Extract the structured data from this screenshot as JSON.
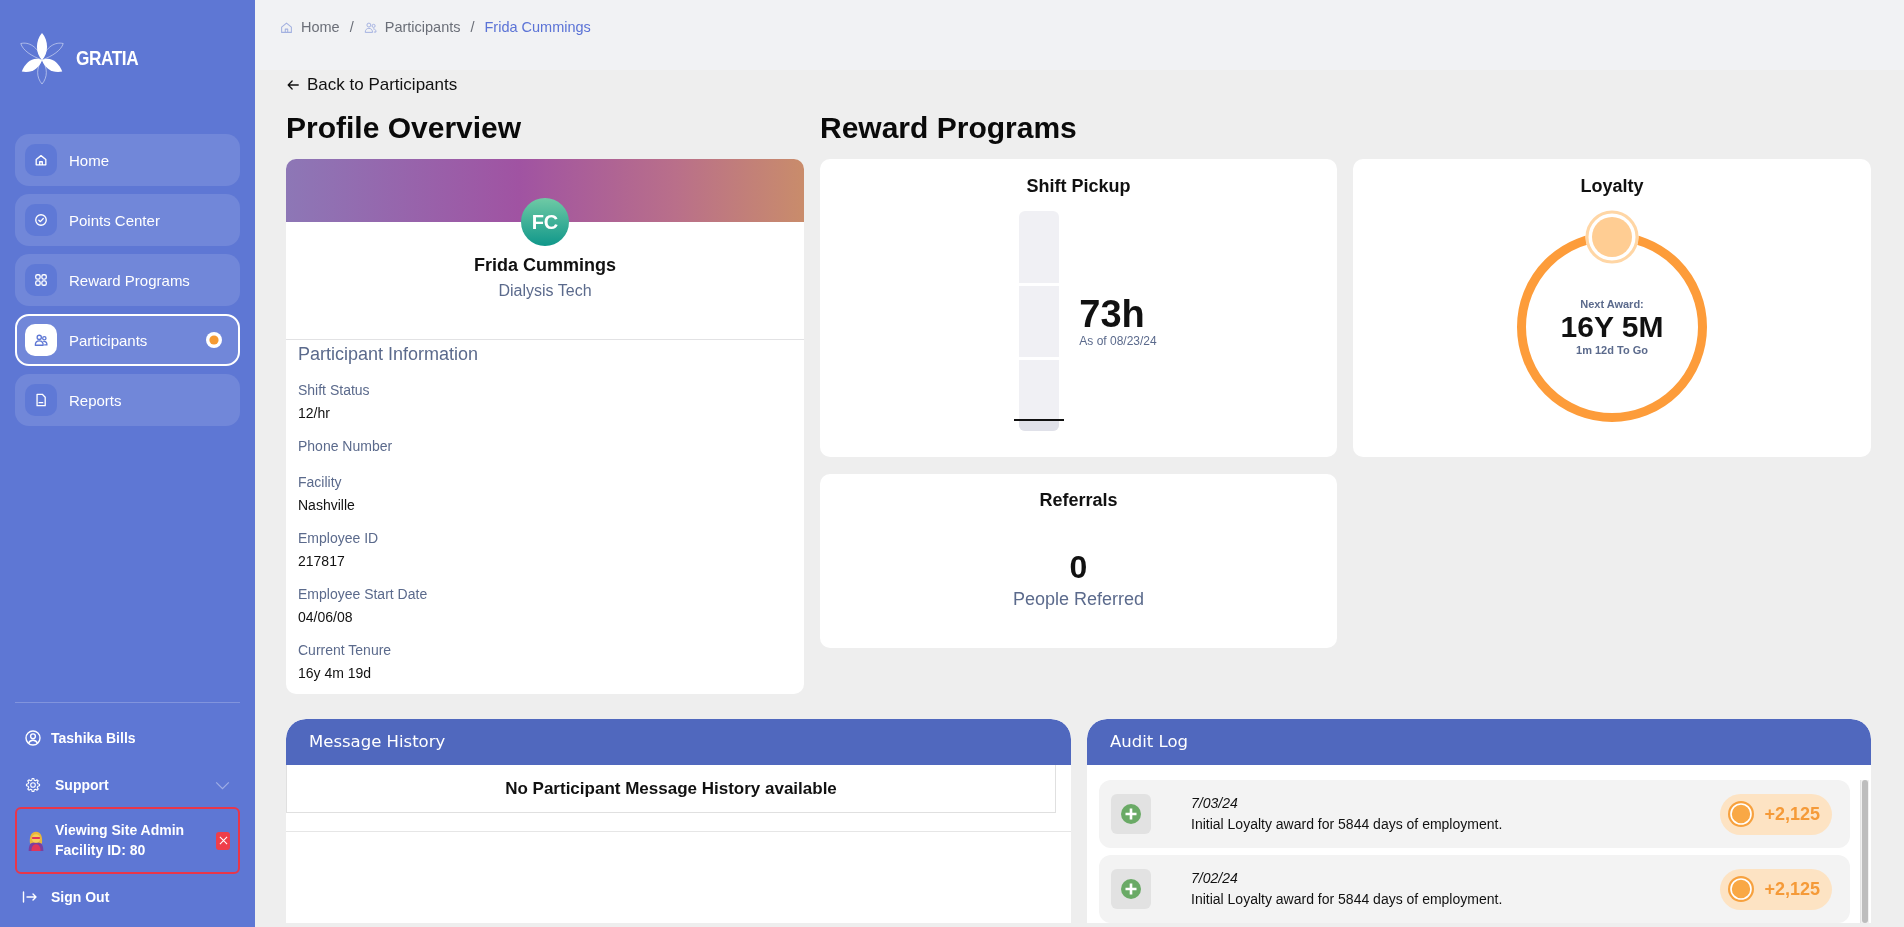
{
  "sidebar": {
    "logo_text": "GRATIA",
    "nav": [
      {
        "label": "Home",
        "selected": false,
        "notification": false
      },
      {
        "label": "Points Center",
        "selected": false,
        "notification": false
      },
      {
        "label": "Reward Programs",
        "selected": false,
        "notification": false
      },
      {
        "label": "Participants",
        "selected": true,
        "notification": true
      },
      {
        "label": "Reports",
        "selected": false,
        "notification": false
      }
    ],
    "user_name": "Tashika Bills",
    "support": {
      "label": "Support",
      "expanded": false
    },
    "impersonation": {
      "title": "Viewing Site Admin",
      "facility": "Facility ID: 80"
    },
    "sign_out": "Sign Out"
  },
  "breadcrumb": [
    {
      "label": "Home",
      "separator": "/",
      "current": false
    },
    {
      "label": "Participants",
      "separator": "/",
      "current": false
    },
    {
      "label": "Frida Cummings",
      "current": true
    }
  ],
  "back_link": "Back to Participants",
  "profile": {
    "title": "Profile Overview",
    "initials": "FC",
    "name": "Frida Cummings",
    "role": "Dialysis Tech",
    "section_title": "Participant Information",
    "fields": [
      {
        "label": "Shift Status",
        "value": "12/hr"
      },
      {
        "label": "Phone Number"
      },
      {
        "label": "Facility",
        "value": "Nashville"
      },
      {
        "label": "Employee ID",
        "value": "217817"
      },
      {
        "label": "Employee Start Date",
        "value": "04/06/08"
      },
      {
        "label": "Current Tenure",
        "value": "16y 4m 19d"
      }
    ]
  },
  "reward_programs": {
    "title": "Reward Programs",
    "shift_pickup": {
      "title": "Shift Pickup",
      "hours": "73h",
      "as_of": "As of 08/23/24",
      "level": 0.05
    },
    "loyalty": {
      "title": "Loyalty",
      "caption": "Next Award:",
      "value": "16Y 5M",
      "remaining": "1m 12d To Go"
    },
    "referrals": {
      "title": "Referrals",
      "count": "0",
      "caption": "People Referred"
    }
  },
  "message_history": {
    "title": "Message History",
    "empty_text": "No Participant Message History available"
  },
  "audit_log": {
    "title": "Audit Log",
    "entries": [
      {
        "date": "7/03/24",
        "description": "Initial Loyalty award for 5844 days of employment.",
        "points": "+2,125"
      },
      {
        "date": "7/02/24",
        "description": "Initial Loyalty award for 5844 days of employment.",
        "points": "+2,125"
      }
    ]
  }
}
